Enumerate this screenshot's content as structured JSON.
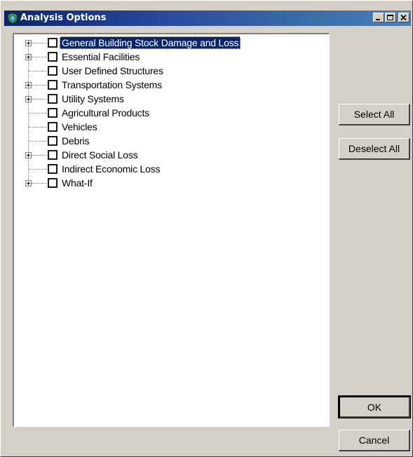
{
  "window": {
    "title": "Analysis Options"
  },
  "tree": {
    "items": [
      {
        "label": "General Building Stock Damage and Loss",
        "expandable": true,
        "checked": false,
        "selected": true
      },
      {
        "label": "Essential Facilities",
        "expandable": true,
        "checked": false,
        "selected": false
      },
      {
        "label": "User Defined Structures",
        "expandable": false,
        "checked": false,
        "selected": false
      },
      {
        "label": "Transportation Systems",
        "expandable": true,
        "checked": false,
        "selected": false
      },
      {
        "label": "Utility Systems",
        "expandable": true,
        "checked": false,
        "selected": false
      },
      {
        "label": "Agricultural Products",
        "expandable": false,
        "checked": false,
        "selected": false
      },
      {
        "label": "Vehicles",
        "expandable": false,
        "checked": false,
        "selected": false
      },
      {
        "label": "Debris",
        "expandable": false,
        "checked": false,
        "selected": false
      },
      {
        "label": "Direct Social Loss",
        "expandable": true,
        "checked": false,
        "selected": false
      },
      {
        "label": "Indirect Economic Loss",
        "expandable": false,
        "checked": false,
        "selected": false
      },
      {
        "label": "What-If",
        "expandable": true,
        "checked": false,
        "selected": false
      }
    ]
  },
  "buttons": {
    "select_all": "Select All",
    "deselect_all": "Deselect All",
    "ok": "OK",
    "cancel": "Cancel"
  },
  "colors": {
    "title_bar": "#0a246a",
    "dialog_bg": "#d4d0c8",
    "selection": "#0a246a"
  },
  "icons": {
    "app": "shield-globe-icon",
    "minimize": "minimize-icon",
    "maximize": "maximize-icon",
    "close": "close-icon"
  }
}
